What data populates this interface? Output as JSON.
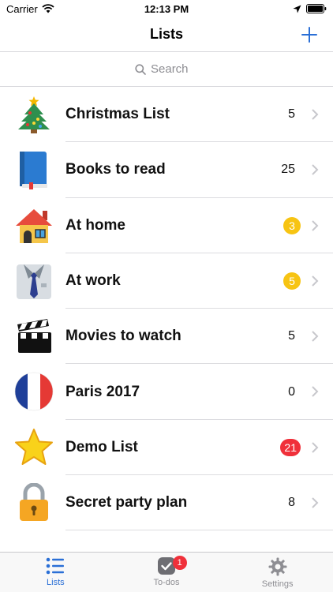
{
  "status_bar": {
    "carrier": "Carrier",
    "time": "12:13 PM"
  },
  "nav": {
    "title": "Lists",
    "add_icon": "plus-icon"
  },
  "search": {
    "placeholder": "Search",
    "value": ""
  },
  "lists": [
    {
      "label": "Christmas List",
      "count": "5",
      "badge": "none",
      "icon": "christmas-tree-icon"
    },
    {
      "label": "Books to read",
      "count": "25",
      "badge": "none",
      "icon": "book-icon"
    },
    {
      "label": "At home",
      "count": "3",
      "badge": "yellow",
      "icon": "house-icon"
    },
    {
      "label": "At work",
      "count": "5",
      "badge": "yellow",
      "icon": "suit-tie-icon"
    },
    {
      "label": "Movies to watch",
      "count": "5",
      "badge": "none",
      "icon": "clapperboard-icon"
    },
    {
      "label": "Paris 2017",
      "count": "0",
      "badge": "none",
      "icon": "france-flag-icon"
    },
    {
      "label": "Demo List",
      "count": "21",
      "badge": "red",
      "icon": "star-icon"
    },
    {
      "label": "Secret party plan",
      "count": "8",
      "badge": "none",
      "icon": "padlock-icon"
    }
  ],
  "tabs": [
    {
      "label": "Lists",
      "icon": "list-icon",
      "active": true
    },
    {
      "label": "To-dos",
      "icon": "checkmark-icon",
      "badge": "1",
      "active": false
    },
    {
      "label": "Settings",
      "icon": "gear-icon",
      "active": false
    }
  ],
  "colors": {
    "accent": "#2a6fd6",
    "badge_yellow": "#f7c413",
    "badge_red": "#f0303a"
  }
}
